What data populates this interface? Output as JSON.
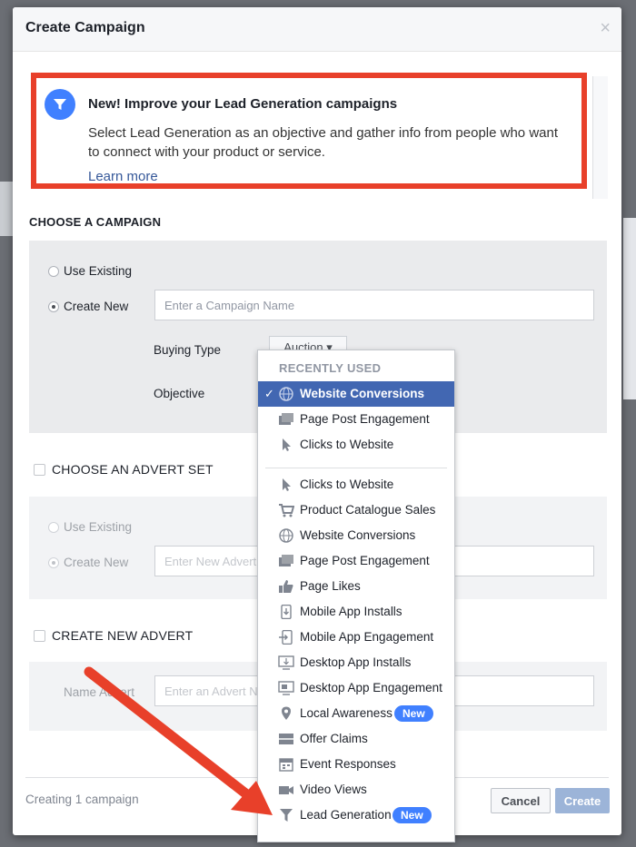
{
  "dialog": {
    "title": "Create Campaign",
    "close_glyph": "×"
  },
  "promo": {
    "title": "New! Improve your Lead Generation campaigns",
    "body": "Select Lead Generation as an objective and gather info from people who want to connect with your product or service.",
    "link": "Learn more",
    "icon": "funnel-icon"
  },
  "campaign": {
    "section_title": "CHOOSE A CAMPAIGN",
    "use_existing": "Use Existing",
    "create_new": "Create New",
    "selected": "Create New",
    "name_placeholder": "Enter a Campaign Name",
    "buying_type_label": "Buying Type",
    "buying_type_value": "Auction ▾",
    "objective_label": "Objective"
  },
  "advert_set": {
    "section_title": "CHOOSE AN ADVERT SET",
    "use_existing": "Use Existing",
    "create_new": "Create New",
    "name_placeholder": "Enter New Advert Set Name"
  },
  "advert": {
    "section_title": "CREATE NEW ADVERT",
    "name_label": "Name Advert",
    "name_placeholder": "Enter an Advert Name"
  },
  "footer": {
    "status": "Creating 1 campaign",
    "cancel": "Cancel",
    "create": "Create"
  },
  "objective_dropdown": {
    "header": "RECENTLY USED",
    "check": "✓",
    "recent": [
      {
        "label": "Website Conversions",
        "icon": "globe-icon",
        "selected": true
      },
      {
        "label": "Page Post Engagement",
        "icon": "page-post-icon"
      },
      {
        "label": "Clicks to Website",
        "icon": "cursor-icon"
      }
    ],
    "all": [
      {
        "label": "Clicks to Website",
        "icon": "cursor-icon"
      },
      {
        "label": "Product Catalogue Sales",
        "icon": "cart-icon"
      },
      {
        "label": "Website Conversions",
        "icon": "globe-icon"
      },
      {
        "label": "Page Post Engagement",
        "icon": "page-post-icon"
      },
      {
        "label": "Page Likes",
        "icon": "thumbs-up-icon"
      },
      {
        "label": "Mobile App Installs",
        "icon": "mobile-install-icon"
      },
      {
        "label": "Mobile App Engagement",
        "icon": "mobile-engage-icon"
      },
      {
        "label": "Desktop App Installs",
        "icon": "desktop-install-icon"
      },
      {
        "label": "Desktop App Engagement",
        "icon": "desktop-engage-icon"
      },
      {
        "label": "Local Awareness",
        "icon": "location-pin-icon",
        "badge": "New"
      },
      {
        "label": "Offer Claims",
        "icon": "offer-icon"
      },
      {
        "label": "Event Responses",
        "icon": "calendar-icon"
      },
      {
        "label": "Video Views",
        "icon": "video-icon"
      },
      {
        "label": "Lead Generation",
        "icon": "funnel-icon",
        "badge": "New"
      }
    ]
  },
  "colors": {
    "accent": "#4267b2",
    "badge": "#4080ff",
    "highlight_border": "#e8402a",
    "annotation_arrow": "#e8402a"
  }
}
